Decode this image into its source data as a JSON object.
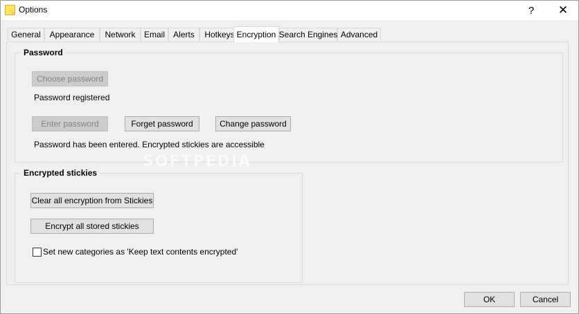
{
  "window": {
    "title": "Options",
    "help_label": "?",
    "close_label": "✕"
  },
  "tabs": [
    {
      "label": "General"
    },
    {
      "label": "Appearance"
    },
    {
      "label": "Network"
    },
    {
      "label": "Email"
    },
    {
      "label": "Alerts"
    },
    {
      "label": "Hotkeys"
    },
    {
      "label": "Encryption",
      "active": true
    },
    {
      "label": "Search Engines"
    },
    {
      "label": "Advanced"
    }
  ],
  "password_group": {
    "title": "Password",
    "choose_password_label": "Choose password",
    "registered_text": "Password registered",
    "enter_password_label": "Enter password",
    "forget_password_label": "Forget password",
    "change_password_label": "Change password",
    "status_text": "Password has been entered.  Encrypted stickies are accessible"
  },
  "encrypted_group": {
    "title": "Encrypted stickies",
    "clear_all_label": "Clear all encryption from Stickies",
    "encrypt_all_label": "Encrypt all stored stickies",
    "keep_encrypted_label": "Set new categories as 'Keep text contents encrypted'",
    "keep_encrypted_checked": false
  },
  "footer": {
    "ok_label": "OK",
    "cancel_label": "Cancel"
  },
  "watermark": "SOFTPEDIA"
}
